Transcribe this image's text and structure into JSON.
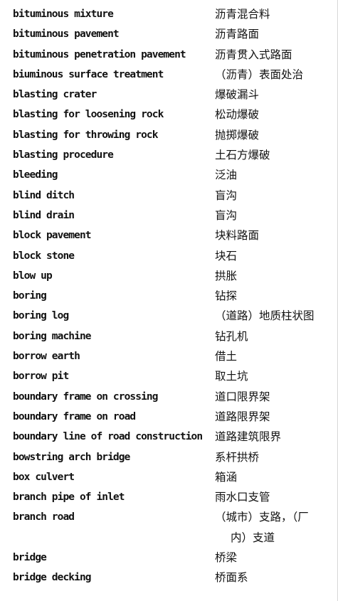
{
  "entries": [
    {
      "term": "bituminous mixture",
      "translation": "沥青混合料"
    },
    {
      "term": "bituminous pavement",
      "translation": "沥青路面"
    },
    {
      "term": "bituminous penetration pavement",
      "translation": "沥青贯入式路面"
    },
    {
      "term": "biuminous surface treatment",
      "translation": "（沥青）表面处治"
    },
    {
      "term": "blasting crater",
      "translation": "爆破漏斗"
    },
    {
      "term": "blasting for loosening rock",
      "translation": "松动爆破"
    },
    {
      "term": "blasting for throwing rock",
      "translation": "抛掷爆破"
    },
    {
      "term": "blasting procedure",
      "translation": "土石方爆破"
    },
    {
      "term": "bleeding",
      "translation": "泛油"
    },
    {
      "term": "blind ditch",
      "translation": "盲沟"
    },
    {
      "term": "blind drain",
      "translation": "盲沟"
    },
    {
      "term": "block pavement",
      "translation": "块料路面"
    },
    {
      "term": "block stone",
      "translation": "块石"
    },
    {
      "term": "blow up",
      "translation": "拱胀"
    },
    {
      "term": "boring",
      "translation": "钻探"
    },
    {
      "term": "boring log",
      "translation": "（道路）地质柱状图"
    },
    {
      "term": "boring machine",
      "translation": "钻孔机"
    },
    {
      "term": "borrow earth",
      "translation": "借土"
    },
    {
      "term": "borrow pit",
      "translation": "取土坑"
    },
    {
      "term": "boundary frame on crossing",
      "translation": "道口限界架"
    },
    {
      "term": "boundary frame on road",
      "translation": "道路限界架"
    },
    {
      "term": "boundary line of road construction",
      "translation": "道路建筑限界"
    },
    {
      "term": "bowstring arch bridge",
      "translation": "系杆拱桥"
    },
    {
      "term": "box culvert",
      "translation": "箱涵"
    },
    {
      "term": "branch pipe of inlet",
      "translation": "雨水口支管"
    },
    {
      "term": "branch road",
      "translation": "（城市）支路，（厂",
      "translation_cont": "内）支道"
    },
    {
      "term": "bridge",
      "translation": "桥梁"
    },
    {
      "term": "bridge decking",
      "translation": "桥面系"
    }
  ]
}
